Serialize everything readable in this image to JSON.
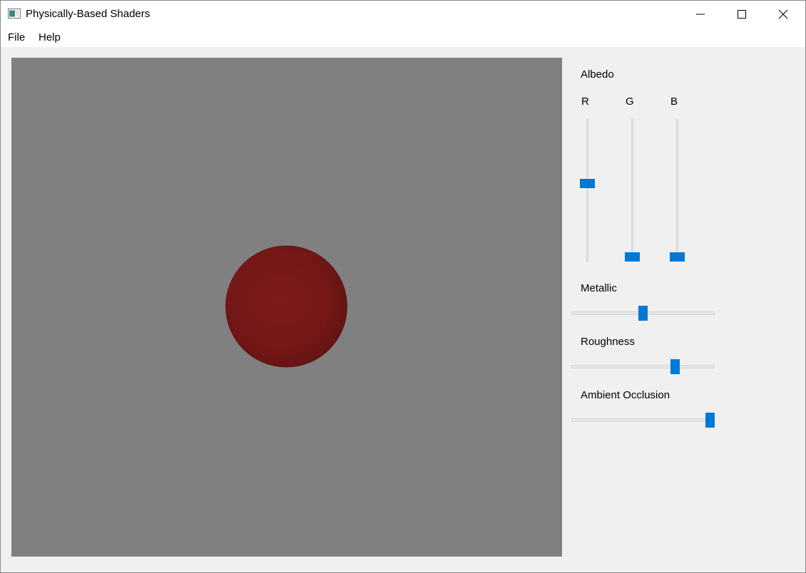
{
  "window": {
    "title": "Physically-Based Shaders",
    "icons": {
      "app": "app-window-icon",
      "minimize": "minimize-icon",
      "maximize": "maximize-icon",
      "close": "close-icon"
    }
  },
  "menu": {
    "file": "File",
    "help": "Help"
  },
  "viewport": {
    "background_color": "#808080",
    "sphere_color": "#7a1a1a"
  },
  "controls": {
    "albedo": {
      "label": "Albedo",
      "r": {
        "label": "R",
        "value_fraction": 0.55
      },
      "g": {
        "label": "G",
        "value_fraction": 0.0
      },
      "b": {
        "label": "B",
        "value_fraction": 0.0
      }
    },
    "metallic": {
      "label": "Metallic",
      "value_fraction": 0.5
    },
    "roughness": {
      "label": "Roughness",
      "value_fraction": 0.74
    },
    "ambient_occlusion": {
      "label": "Ambient Occlusion",
      "value_fraction": 1.0
    }
  },
  "accent_color": "#0078d7"
}
